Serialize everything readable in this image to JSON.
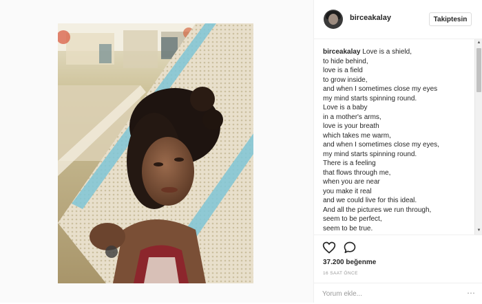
{
  "post": {
    "username": "birceakalay",
    "follow_label": "Takiptesin",
    "caption_user": "birceakalay",
    "caption_lines": [
      "Love is a shield,",
      "to hide behind,",
      "love is a field",
      "to grow inside,",
      "and when I sometimes close my eyes",
      "my mind starts spinning round.",
      "Love is a baby",
      "in a mother's arms,",
      "love is your breath",
      "which takes me warm,",
      "and when I sometimes close my eyes,",
      "my mind starts spinning round.",
      "There is a feeling",
      "that flows through me,",
      "when you are near",
      "you make it real",
      "and we could live for this ideal.",
      "And all the pictures we run through,",
      "seem to be perfect,",
      "seem to be true."
    ],
    "likes": "37.200 beğenme",
    "time": "16 SAAT ÖNCE",
    "comment_placeholder": "Yorum ekle...",
    "more_icon": "more-dots-icon"
  },
  "icons": {
    "like": "heart-outline-icon",
    "comment": "speech-bubble-icon"
  },
  "colors": {
    "text": "#262626",
    "muted": "#999999",
    "border": "#efefef",
    "hammock_blue": "#7fc6d6"
  }
}
